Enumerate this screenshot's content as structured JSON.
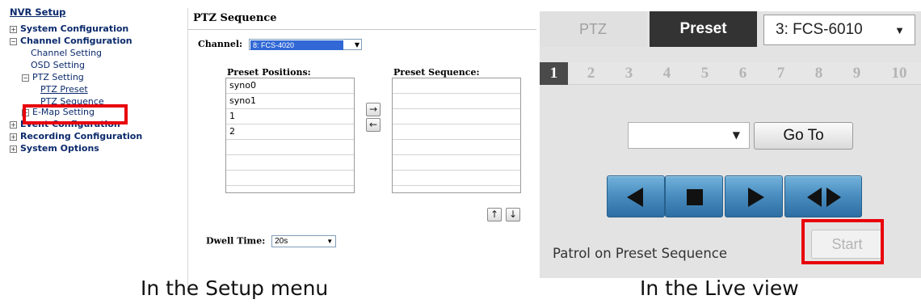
{
  "setup_menu": {
    "title": "NVR Setup",
    "items": [
      {
        "expander": "⊞",
        "label": "System Configuration"
      },
      {
        "expander": "⊟",
        "label": "Channel Configuration"
      },
      {
        "label": "Channel Setting"
      },
      {
        "label": "OSD Setting"
      },
      {
        "expander": "⊟",
        "label": "PTZ Setting"
      },
      {
        "label": "PTZ Preset"
      },
      {
        "label": "PTZ Sequence"
      },
      {
        "expander": "⊞",
        "label": "E-Map Setting"
      },
      {
        "expander": "⊞",
        "label": "Event Configuration"
      },
      {
        "expander": "⊞",
        "label": "Recording Configuration"
      },
      {
        "expander": "⊞",
        "label": "System Options"
      }
    ],
    "highlight_color": "#e8000b"
  },
  "sequence_panel": {
    "title": "PTZ Sequence",
    "channel_label": "Channel:",
    "channel_value": "8: FCS-4020",
    "preset_positions_label": "Preset Positions:",
    "preset_positions": [
      "syno0",
      "syno1",
      "1",
      "2",
      "",
      "",
      "",
      ""
    ],
    "preset_sequence_label": "Preset Sequence:",
    "preset_sequence": [
      "",
      "",
      "",
      "",
      "",
      "",
      "",
      ""
    ],
    "add_arrow": "→",
    "remove_arrow": "←",
    "up_arrow": "↑",
    "down_arrow": "↓",
    "dwell_label": "Dwell Time:",
    "dwell_value": "20s"
  },
  "live_view": {
    "tab_ptz": "PTZ",
    "tab_preset": "Preset",
    "camera_value": "3: FCS-6010",
    "number_tabs": [
      "1",
      "2",
      "3",
      "4",
      "5",
      "6",
      "7",
      "8",
      "9",
      "10"
    ],
    "active_number_tab": "1",
    "preset_value": "",
    "goto_label": "Go To",
    "controls": [
      "prev-icon",
      "stop-icon",
      "play-icon",
      "prev-next-icon"
    ],
    "patrol_label": "Patrol on Preset Sequence",
    "start_label": "Start",
    "button_blue": "#4b8ec0"
  },
  "captions": {
    "setup": "In the Setup menu",
    "live": "In the Live view"
  }
}
